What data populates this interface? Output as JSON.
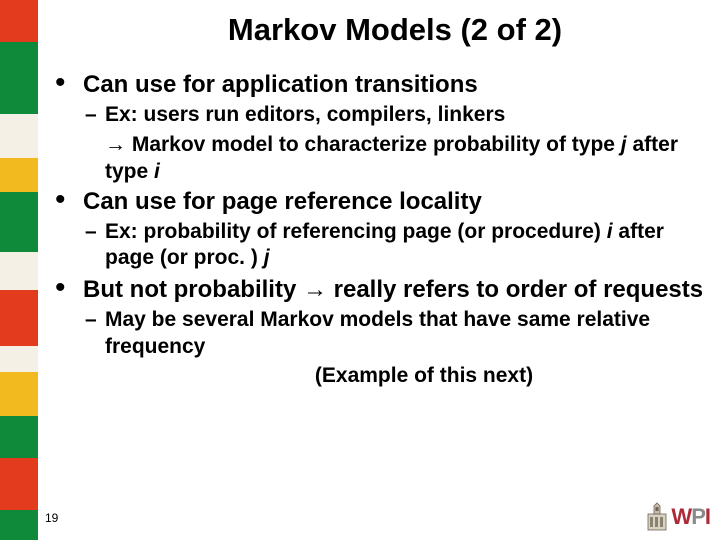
{
  "title": "Markov Models (2 of 2)",
  "bullets": {
    "b1": {
      "text": "Can use for application transitions"
    },
    "b1s1": "Ex: users run editors, compilers, linkers",
    "b1extra": "→ Markov model to characterize probability of type j after type i",
    "b2": {
      "text": "Can use for page reference locality"
    },
    "b2s1": "Ex: probability of referencing page (or procedure) i after page (or proc. ) j",
    "b3": {
      "text": "But not probability → really refers to order of requests"
    },
    "b3s1": "May be several Markov models that have same relative frequency",
    "example_note": "(Example of this next)"
  },
  "slide_number": "19",
  "sidebar_colors": [
    {
      "c": "#e23b1e",
      "h": 42
    },
    {
      "c": "#0f8a3a",
      "h": 72
    },
    {
      "c": "#f4f0e6",
      "h": 44
    },
    {
      "c": "#f2ba1f",
      "h": 34
    },
    {
      "c": "#0f8a3a",
      "h": 60
    },
    {
      "c": "#f4f0e6",
      "h": 38
    },
    {
      "c": "#e23b1e",
      "h": 56
    },
    {
      "c": "#f4f0e6",
      "h": 26
    },
    {
      "c": "#f2ba1f",
      "h": 44
    },
    {
      "c": "#0f8a3a",
      "h": 42
    },
    {
      "c": "#e23b1e",
      "h": 52
    },
    {
      "c": "#0f8a3a",
      "h": 30
    }
  ],
  "logo": {
    "letters": [
      "W",
      "P",
      "I"
    ]
  }
}
